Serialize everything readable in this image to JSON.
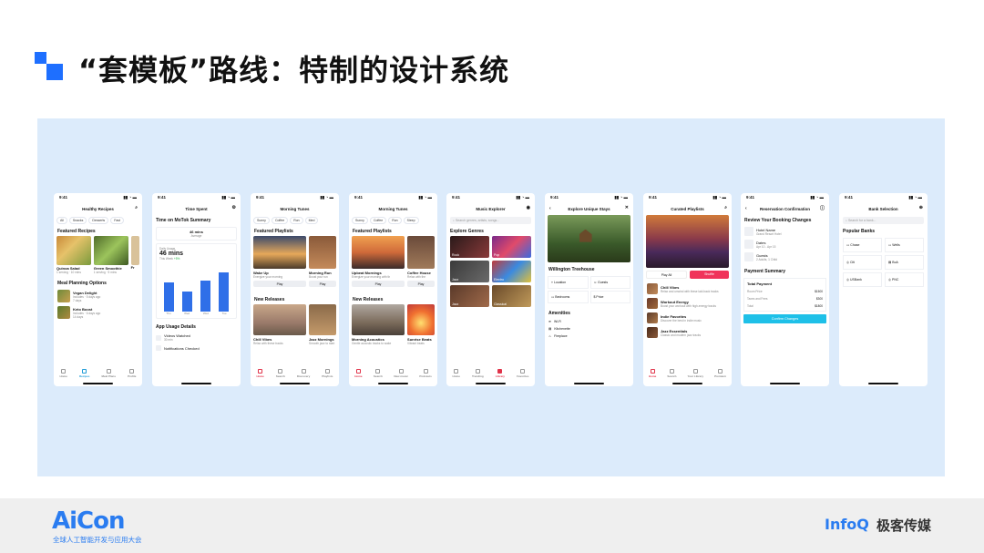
{
  "slide": {
    "title": "“套模板”路线：特制的设计系统"
  },
  "footer": {
    "brand": "AiCon",
    "brand_sub": "全球人工智能开发与应用大会",
    "partner1": "InfoQ",
    "partner2": "极客传媒"
  },
  "status_time": "9:41",
  "phones": {
    "p1": {
      "title": "Healthy Recipes",
      "chips": [
        "All",
        "Snacks",
        "Desserts",
        "Fast"
      ],
      "section1": "Featured Recipes",
      "cards": [
        {
          "name": "Quinoa Salad",
          "meta": "1 serving · 10 mins"
        },
        {
          "name": "Green Smoothie",
          "meta": "1 serving · 5 mins"
        },
        {
          "name": "Fr",
          "meta": ""
        }
      ],
      "section2": "Meal Planning Options",
      "plans": [
        {
          "name": "Vegan Delight",
          "meta": "Includes · 5 days ago",
          "meta2": "7 days"
        },
        {
          "name": "Keto Boost",
          "meta": "Includes · 6 days ago",
          "meta2": "14 days"
        }
      ],
      "tabs": [
        "Home",
        "Recipes",
        "Meal Plans",
        "Profile"
      ]
    },
    "p2": {
      "title": "Time Spent",
      "section1": "Time on MoTok Summary",
      "avg_value": "46 mins",
      "avg_label": "Average",
      "daily_label": "Daily Usage",
      "daily_value": "46 mins",
      "week_label": "This Week",
      "week_change": "+5%",
      "bar_labels": [
        "Thu",
        "Wed",
        "Wed",
        "Tue"
      ],
      "bar_values": [
        0.62,
        0.42,
        0.66,
        0.82
      ],
      "section2": "App Usage Details",
      "details": [
        {
          "name": "Videos Watched",
          "meta": "30 min"
        },
        {
          "name": "Notifications Checked",
          "meta": ""
        }
      ]
    },
    "p3": {
      "title": "Morning Tunes",
      "chips": [
        "Sunny",
        "Coffee",
        "Run",
        "Med"
      ],
      "section1": "Featured Playlists",
      "cards": [
        {
          "name": "Wake Up",
          "meta": "Energize your morning",
          "btn": "Play"
        },
        {
          "name": "Morning Run",
          "meta": "Boost your run",
          "btn": "Play"
        }
      ],
      "section2": "New Releases",
      "releases": [
        {
          "name": "Chill Vibes",
          "meta": "Relax with these tracks"
        },
        {
          "name": "Jazz Mornings",
          "meta": "Smooth jazz to start"
        }
      ],
      "tabs": [
        "Home",
        "Search",
        "Discovery",
        "Playlists"
      ]
    },
    "p4": {
      "title": "Morning Tunes",
      "chips": [
        "Sunny",
        "Coffee",
        "Run",
        "Sleep"
      ],
      "section1": "Featured Playlists",
      "cards": [
        {
          "name": "Upbeat Mornings",
          "meta": "Energize your morning with th",
          "btn": "Play"
        },
        {
          "name": "Coffee House",
          "meta": "Relax with the",
          "btn": "Play"
        }
      ],
      "section2": "New Releases",
      "releases": [
        {
          "name": "Morning Acoustics",
          "meta": "Gentle acoustic tracks to wake"
        },
        {
          "name": "Sunrise Beats",
          "meta": "Vibrant beats"
        }
      ],
      "tabs": [
        "Home",
        "Search",
        "New music",
        "Podcasts"
      ]
    },
    "p5": {
      "title": "Music Explorer",
      "search_placeholder": "Search genres, artists, songs...",
      "section1": "Explore Genres",
      "genres": [
        "Rock",
        "Pop",
        "Jazz",
        "Electro",
        "Jazz",
        "Classical"
      ],
      "tabs": [
        "Home",
        "Trending",
        "Library",
        "Favorites"
      ]
    },
    "p6": {
      "title": "Explore Unique Stays",
      "place": "Willington Treehouse",
      "features": [
        "Location",
        "Guests",
        "Bedrooms",
        "Price"
      ],
      "amenities_title": "Amenities",
      "amenities": [
        "Wi-Fi",
        "Kitchenette",
        "Fireplace"
      ]
    },
    "p7": {
      "title": "Curated Playlists",
      "btn1": "Play All",
      "btn2": "Shuffle",
      "tracks": [
        {
          "name": "Chill Vibes",
          "meta": "Relax and unwind with these laid-back tracks"
        },
        {
          "name": "Workout Energy",
          "meta": "Boost your workout with high-energy tracks"
        },
        {
          "name": "Indie Favorites",
          "meta": "Discover the best in indie music"
        },
        {
          "name": "Jazz Essentials",
          "meta": "Classic and modern jazz tracks"
        }
      ],
      "tabs": [
        "Home",
        "Search",
        "Your Library",
        "Premium"
      ]
    },
    "p8": {
      "title": "Reservation Confirmation",
      "section1": "Review Your Booking Changes",
      "items": [
        {
          "name": "Hotel Name",
          "meta": "Grand Resort Hotel"
        },
        {
          "name": "Dates",
          "meta": "Apr 10 - Apr 15"
        },
        {
          "name": "Guests",
          "meta": "2 Adults, 1 Child"
        }
      ],
      "section2": "Payment Summary",
      "total_payment": "Total Payment",
      "lines": [
        {
          "label": "Room Price",
          "value": "$1500"
        },
        {
          "label": "Taxes and Fees",
          "value": "$300"
        },
        {
          "label": "Total",
          "value": "$1800"
        }
      ],
      "confirm": "Confirm Changes"
    },
    "p9": {
      "title": "Bank Selection",
      "search_placeholder": "Search for a bank...",
      "section1": "Popular Banks",
      "banks": [
        "Chase",
        "Wells",
        "Citi",
        "BoA",
        "USBank",
        "PNC"
      ]
    }
  }
}
